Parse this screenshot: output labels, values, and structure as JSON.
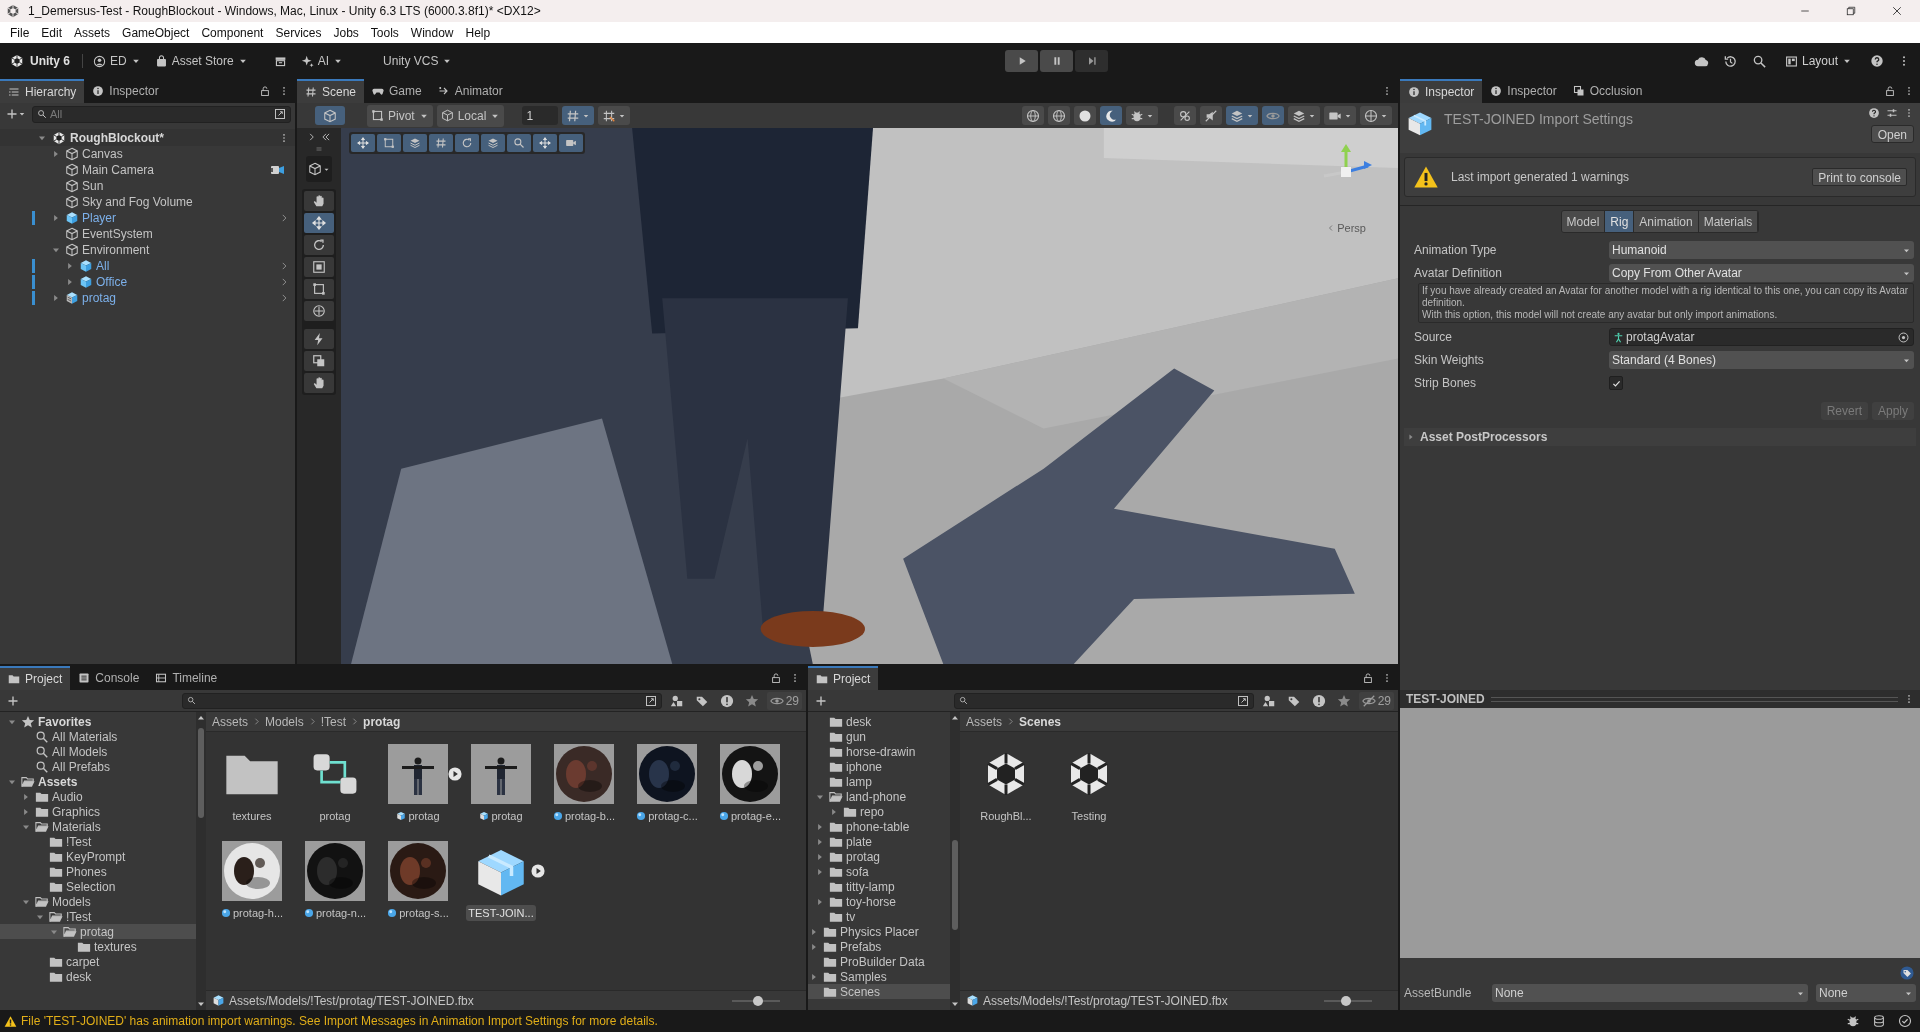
{
  "window": {
    "title": "1_Demersus-Test - RoughBlockout - Windows, Mac, Linux - Unity 6.3 LTS (6000.3.8f1)* <DX12>"
  },
  "menu": [
    "File",
    "Edit",
    "Assets",
    "GameObject",
    "Component",
    "Services",
    "Jobs",
    "Tools",
    "Window",
    "Help"
  ],
  "main_toolbar": {
    "product": "Unity 6",
    "account": "ED",
    "asset_store": "Asset Store",
    "ai": "AI",
    "version_control": "Unity VCS",
    "layout": "Layout"
  },
  "hierarchy": {
    "tabs": [
      {
        "label": "Hierarchy",
        "selected": true
      },
      {
        "label": "Inspector",
        "selected": false
      }
    ],
    "search": {
      "placeholder": "All"
    },
    "scene": "RoughBlockout*",
    "items": [
      {
        "label": "Canvas",
        "kind": "object",
        "expanded": false
      },
      {
        "label": "Main Camera",
        "kind": "camera"
      },
      {
        "label": "Sun",
        "kind": "object"
      },
      {
        "label": "Sky and Fog Volume",
        "kind": "object"
      },
      {
        "label": "Player",
        "kind": "prefab",
        "expanded": false
      },
      {
        "label": "EventSystem",
        "kind": "object"
      },
      {
        "label": "Environment",
        "kind": "object",
        "expanded": true,
        "children": [
          {
            "label": "All",
            "kind": "prefab",
            "expanded": false
          },
          {
            "label": "Office",
            "kind": "prefab",
            "expanded": false
          }
        ]
      },
      {
        "label": "protag",
        "kind": "model_prefab",
        "expanded": false
      }
    ]
  },
  "scene_view": {
    "tabs": [
      {
        "label": "Scene",
        "selected": true
      },
      {
        "label": "Game",
        "selected": false
      },
      {
        "label": "Animator",
        "selected": false
      }
    ],
    "pivot": "Pivot",
    "space": "Local",
    "grid_size": "1",
    "camera_label": "Persp"
  },
  "inspector": {
    "tabs": [
      {
        "label": "Inspector",
        "selected": true
      },
      {
        "label": "Inspector",
        "selected": false
      },
      {
        "label": "Occlusion",
        "selected": false
      }
    ],
    "title": "TEST-JOINED Import Settings",
    "open_button": "Open",
    "warning": "Last import generated 1 warnings",
    "print_button": "Print to console",
    "section_tabs": [
      {
        "label": "Model",
        "selected": false
      },
      {
        "label": "Rig",
        "selected": true
      },
      {
        "label": "Animation",
        "selected": false
      },
      {
        "label": "Materials",
        "selected": false
      }
    ],
    "fields": [
      {
        "kind": "dropdown",
        "label": "Animation Type",
        "value": "Humanoid"
      },
      {
        "kind": "dropdown",
        "label": "Avatar Definition",
        "value": "Copy From Other Avatar"
      },
      {
        "kind": "help",
        "text": "If you have already created an Avatar for another model with a rig identical to this one, you can copy its Avatar definition.\nWith this option, this model will not create any avatar but only import animations."
      },
      {
        "kind": "object",
        "label": "Source",
        "value": "protagAvatar"
      },
      {
        "kind": "dropdown",
        "label": "Skin Weights",
        "value": "Standard (4 Bones)"
      },
      {
        "kind": "checkbox",
        "label": "Strip Bones",
        "checked": true
      }
    ],
    "buttons": [
      {
        "label": "Revert",
        "disabled": true
      },
      {
        "label": "Apply",
        "disabled": true
      }
    ],
    "foldouts": [
      {
        "label": "Asset PostProcessors",
        "expanded": false
      }
    ],
    "preview": {
      "title": "TEST-JOINED"
    },
    "asset_bundle": {
      "label": "AssetBundle",
      "name": "None",
      "variant": "None"
    }
  },
  "project_left": {
    "tabs": [
      {
        "label": "Project",
        "selected": true
      },
      {
        "label": "Console",
        "selected": false
      },
      {
        "label": "Timeline",
        "selected": false
      }
    ],
    "hidden_count": "29",
    "tree": [
      {
        "label": "Favorites",
        "kind": "favorites",
        "expanded": true,
        "selected": false,
        "children": [
          {
            "label": "All Materials",
            "kind": "search",
            "selected": false
          },
          {
            "label": "All Models",
            "kind": "search",
            "selected": false
          },
          {
            "label": "All Prefabs",
            "kind": "search",
            "selected": false
          }
        ]
      },
      {
        "label": "Assets",
        "kind": "root",
        "expanded": true,
        "selected": false,
        "children": [
          {
            "label": "Audio",
            "kind": "folder",
            "expanded": false,
            "selected": false
          },
          {
            "label": "Graphics",
            "kind": "folder",
            "expanded": false,
            "selected": false
          },
          {
            "label": "Materials",
            "kind": "folder",
            "expanded": true,
            "selected": false,
            "children": [
              {
                "label": "!Test",
                "kind": "folder",
                "selected": false
              },
              {
                "label": "KeyPrompt",
                "kind": "folder",
                "selected": false
              },
              {
                "label": "Phones",
                "kind": "folder",
                "selected": false
              },
              {
                "label": "Selection",
                "kind": "folder",
                "selected": false
              }
            ]
          },
          {
            "label": "Models",
            "kind": "folder",
            "expanded": true,
            "selected": false,
            "children": [
              {
                "label": "!Test",
                "kind": "folder",
                "expanded": true,
                "selected": false,
                "children": [
                  {
                    "label": "protag",
                    "kind": "folder",
                    "expanded": true,
                    "selected": true,
                    "children": [
                      {
                        "label": "textures",
                        "kind": "folder",
                        "selected": false
                      }
                    ]
                  }
                ]
              },
              {
                "label": "carpet",
                "kind": "folder",
                "selected": false
              },
              {
                "label": "desk",
                "kind": "folder",
                "selected": false
              }
            ]
          }
        ]
      }
    ],
    "breadcrumb": [
      "Assets",
      "Models",
      "!Test",
      "protag"
    ],
    "assets": [
      {
        "label": "textures",
        "kind": "folder",
        "expandable": false,
        "selected": false
      },
      {
        "label": "protag",
        "kind": "linked",
        "expandable": false,
        "selected": false
      },
      {
        "label": "protag",
        "kind": "model",
        "expandable": true,
        "selected": false
      },
      {
        "label": "protag",
        "kind": "model",
        "expandable": false,
        "selected": false
      },
      {
        "label": "protag-b...",
        "kind": "material",
        "expandable": false,
        "selected": false
      },
      {
        "label": "protag-c...",
        "kind": "material",
        "expandable": false,
        "selected": false
      },
      {
        "label": "protag-e...",
        "kind": "material",
        "expandable": false,
        "selected": false
      },
      {
        "label": "protag-h...",
        "kind": "material",
        "expandable": false,
        "selected": false
      },
      {
        "label": "protag-n...",
        "kind": "material",
        "expandable": false,
        "selected": false
      },
      {
        "label": "protag-s...",
        "kind": "material",
        "expandable": false,
        "selected": false
      },
      {
        "label": "TEST-JOIN...",
        "kind": "fbx",
        "expandable": true,
        "selected": true
      }
    ],
    "path": "Assets/Models/!Test/protag/TEST-JOINED.fbx",
    "thumbnail_size": {
      "level": 0.55
    }
  },
  "project_right": {
    "tabs": [
      {
        "label": "Project",
        "selected": true
      }
    ],
    "hidden_count": "29",
    "tree": [
      {
        "kind": "continued",
        "children": [
          {
            "label": "desk",
            "kind": "folder",
            "selected": false
          },
          {
            "label": "gun",
            "kind": "folder",
            "selected": false
          },
          {
            "label": "horse-drawin",
            "kind": "folder",
            "selected": false
          },
          {
            "label": "iphone",
            "kind": "folder",
            "selected": false
          },
          {
            "label": "lamp",
            "kind": "folder",
            "selected": false
          },
          {
            "label": "land-phone",
            "kind": "folder",
            "expanded": true,
            "selected": false,
            "children": [
              {
                "label": "repo",
                "kind": "folder",
                "expanded": false,
                "selected": false
              }
            ]
          },
          {
            "label": "phone-table",
            "kind": "folder",
            "expanded": false,
            "selected": false
          },
          {
            "label": "plate",
            "kind": "folder",
            "expanded": false,
            "selected": false
          },
          {
            "label": "protag",
            "kind": "folder",
            "expanded": false,
            "selected": false
          },
          {
            "label": "sofa",
            "kind": "folder",
            "expanded": false,
            "selected": false
          },
          {
            "label": "titty-lamp",
            "kind": "folder",
            "selected": false
          },
          {
            "label": "toy-horse",
            "kind": "folder",
            "expanded": false,
            "selected": false
          },
          {
            "label": "tv",
            "kind": "folder",
            "selected": false
          }
        ]
      },
      {
        "label": "Physics Placer",
        "kind": "folder",
        "expanded": false,
        "selected": false
      },
      {
        "label": "Prefabs",
        "kind": "folder",
        "expanded": false,
        "selected": false
      },
      {
        "label": "ProBuilder Data",
        "kind": "folder",
        "selected": false
      },
      {
        "label": "Samples",
        "kind": "folder",
        "expanded": false,
        "selected": false
      },
      {
        "label": "Scenes",
        "kind": "folder",
        "selected": true
      }
    ],
    "breadcrumb": [
      "Assets",
      "Scenes"
    ],
    "assets": [
      {
        "label": "RoughBl...",
        "kind": "scene",
        "expandable": false,
        "selected": false
      },
      {
        "label": "Testing",
        "kind": "scene",
        "expandable": false,
        "selected": false
      }
    ],
    "path": "Assets/Models/!Test/protag/TEST-JOINED.fbx",
    "thumbnail_size": {
      "level": 0.45
    }
  },
  "status_bar": {
    "message": "File 'TEST-JOINED' has animation import warnings. See Import Messages in Animation Import Settings for more details."
  }
}
